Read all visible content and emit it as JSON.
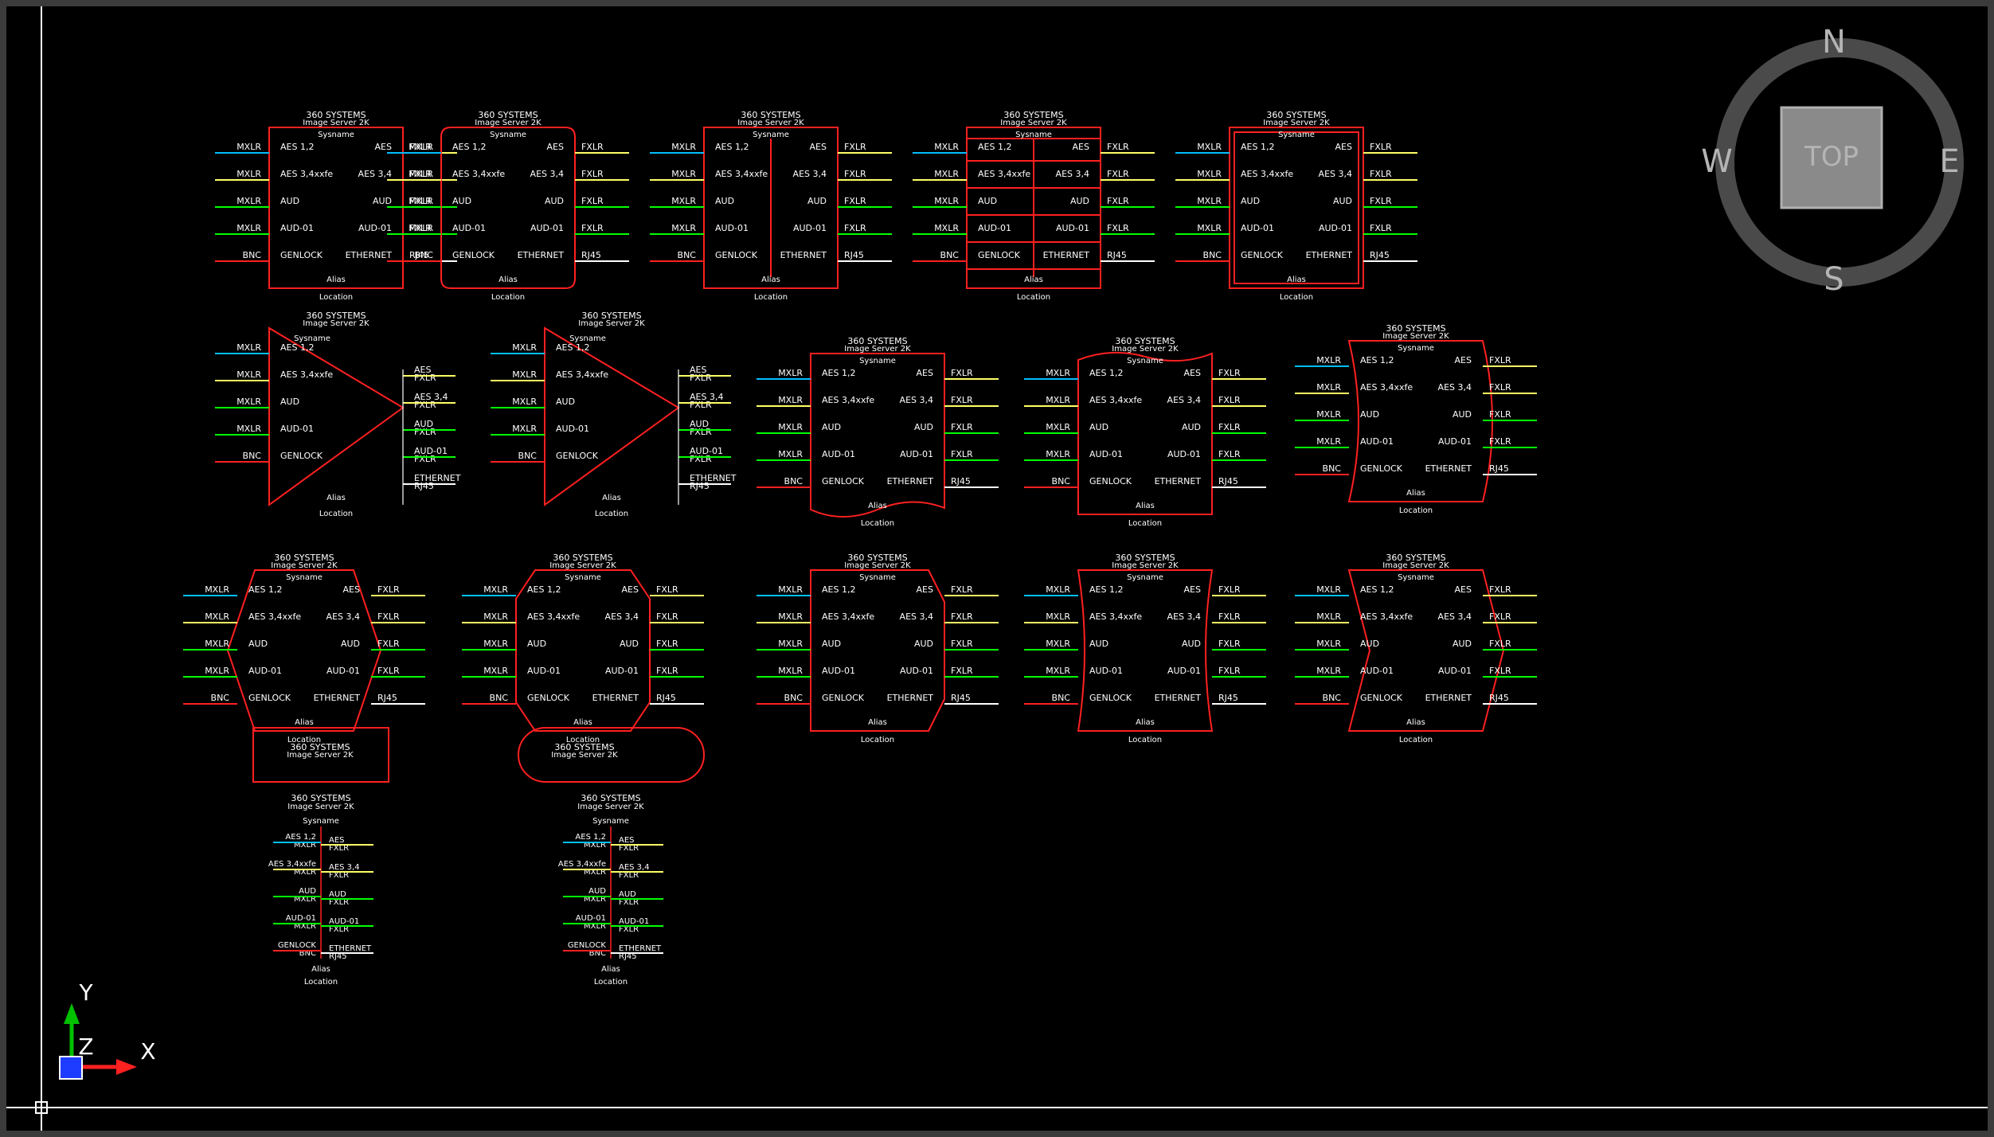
{
  "block": {
    "manufacturer": "360 SYSTEMS",
    "model": "Image Server 2K",
    "sysname": "Sysname",
    "alias": "Alias",
    "location": "Location",
    "inputs": [
      {
        "port": "AES 1,2",
        "signal": "MXLR",
        "color": "#00bfff"
      },
      {
        "port": "AES 3,4xxfe",
        "signal": "MXLR",
        "color": "#ffff66"
      },
      {
        "port": "AUD",
        "signal": "MXLR",
        "color": "#00ff00"
      },
      {
        "port": "AUD-01",
        "signal": "MXLR",
        "color": "#00ff00"
      },
      {
        "port": "GENLOCK",
        "signal": "BNC",
        "color": "#ff2020"
      }
    ],
    "outputs": [
      {
        "port": "AES",
        "signal": "FXLR",
        "color": "#ffff66"
      },
      {
        "port": "AES 3,4",
        "signal": "FXLR",
        "color": "#ffff66"
      },
      {
        "port": "AUD",
        "signal": "FXLR",
        "color": "#00ff00"
      },
      {
        "port": "AUD-01",
        "signal": "FXLR",
        "color": "#00ff00"
      },
      {
        "port": "ETHERNET",
        "signal": "RJ45",
        "color": "#ffffff"
      }
    ]
  },
  "colors": {
    "background": "#000000",
    "frame": "#3b3b3b",
    "shape_outline": "#ff2020"
  },
  "viewcube": {
    "face_label": "TOP",
    "north": "N",
    "south": "S",
    "east": "E",
    "west": "W"
  },
  "ucs": {
    "x_label": "X",
    "y_label": "Y",
    "z_label": "Z"
  },
  "symbols": [
    {
      "id": "rect-plain",
      "shape": "rect"
    },
    {
      "id": "rect-rounded",
      "shape": "rounded"
    },
    {
      "id": "rect-vdivider",
      "shape": "vdivider"
    },
    {
      "id": "rect-grid",
      "shape": "grid"
    },
    {
      "id": "rect-double",
      "shape": "double"
    },
    {
      "id": "triangle",
      "shape": "triangle"
    },
    {
      "id": "triangle-2",
      "shape": "triangle"
    },
    {
      "id": "document",
      "shape": "document"
    },
    {
      "id": "banner",
      "shape": "banner"
    },
    {
      "id": "curved-sides",
      "shape": "curved"
    },
    {
      "id": "hexagon",
      "shape": "hexagon"
    },
    {
      "id": "octagon",
      "shape": "octagon"
    },
    {
      "id": "cut-corners",
      "shape": "cut"
    },
    {
      "id": "drum",
      "shape": "drum"
    },
    {
      "id": "chevron",
      "shape": "chevron"
    },
    {
      "id": "header-rect",
      "shape": "headerrect"
    },
    {
      "id": "header-pill",
      "shape": "headerpill"
    }
  ]
}
